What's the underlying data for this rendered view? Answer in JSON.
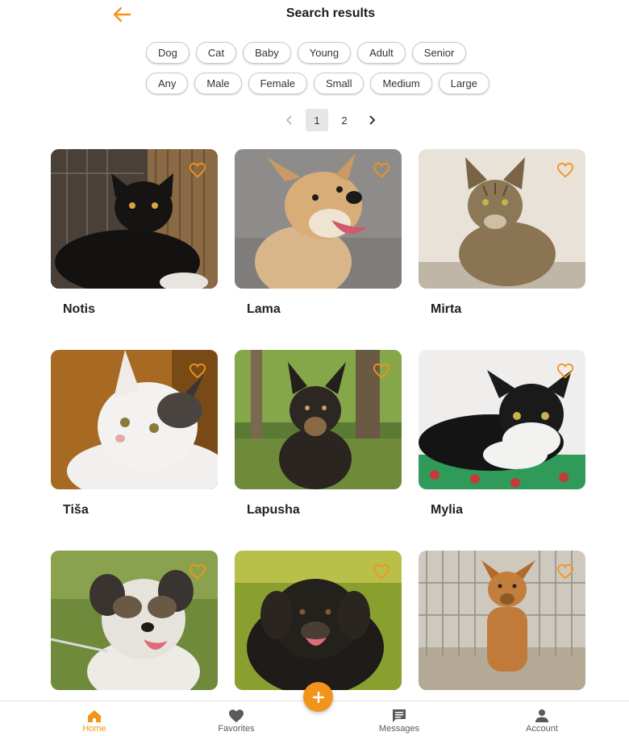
{
  "header": {
    "title": "Search results",
    "back_icon": "arrow-left-icon"
  },
  "colors": {
    "accent": "#f2941b",
    "chip_border": "#c9c9c9",
    "active_page_bg": "#e6e6e6"
  },
  "filters": {
    "row1": [
      "Dog",
      "Cat",
      "Baby",
      "Young",
      "Adult",
      "Senior"
    ],
    "row2": [
      "Any",
      "Male",
      "Female",
      "Small",
      "Medium",
      "Large"
    ]
  },
  "pagination": {
    "prev_icon": "chevron-left-icon",
    "pages": [
      "1",
      "2"
    ],
    "current_page": "1",
    "next_icon": "chevron-right-icon"
  },
  "pets": [
    {
      "name": "Notis",
      "photo": "black-cat-photo"
    },
    {
      "name": "Lama",
      "photo": "tan-dog-photo"
    },
    {
      "name": "Mirta",
      "photo": "tabby-cat-photo"
    },
    {
      "name": "Tiša",
      "photo": "white-cat-photo"
    },
    {
      "name": "Lapusha",
      "photo": "black-dog-forest-photo"
    },
    {
      "name": "Mylia",
      "photo": "tuxedo-cat-photo"
    },
    {
      "name": "",
      "photo": "terrier-dog-photo"
    },
    {
      "name": "",
      "photo": "black-fluffy-dog-photo"
    },
    {
      "name": "",
      "photo": "ginger-dog-cage-photo"
    }
  ],
  "nav": {
    "items": [
      {
        "label": "Home",
        "icon": "home-icon",
        "active": true
      },
      {
        "label": "Favorites",
        "icon": "heart-icon",
        "active": false
      },
      {
        "label": "Messages",
        "icon": "message-icon",
        "active": false
      },
      {
        "label": "Account",
        "icon": "person-icon",
        "active": false
      }
    ],
    "fab_icon": "plus-icon"
  }
}
